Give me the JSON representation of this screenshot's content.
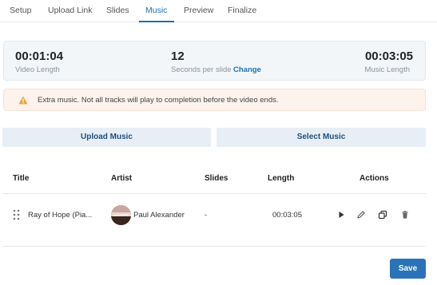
{
  "tabs": [
    {
      "label": "Setup"
    },
    {
      "label": "Upload Link"
    },
    {
      "label": "Slides"
    },
    {
      "label": "Music",
      "active": true
    },
    {
      "label": "Preview"
    },
    {
      "label": "Finalize"
    }
  ],
  "stats": {
    "video_length_value": "00:01:04",
    "video_length_label": "Video Length",
    "seconds_value": "12",
    "seconds_label": "Seconds per slide",
    "change_label": "Change",
    "music_length_value": "00:03:05",
    "music_length_label": "Music Length"
  },
  "warning": {
    "icon": "warning-triangle-icon",
    "text": "Extra music. Not all tracks will play to completion before the video ends."
  },
  "buttons": {
    "upload": "Upload Music",
    "select": "Select Music",
    "save": "Save"
  },
  "table": {
    "headers": [
      "Title",
      "Artist",
      "Slides",
      "Length",
      "Actions"
    ],
    "rows": [
      {
        "title": "Ray of Hope (Pia...",
        "artist": "Paul Alexander",
        "slides": "-",
        "length": "00:03:05"
      }
    ],
    "actions": [
      "play-icon",
      "edit-pencil-icon",
      "duplicate-icon",
      "trash-icon"
    ]
  },
  "colors": {
    "accent": "#1f6fb2",
    "warning_bg": "#fdf3ec",
    "warning_icon": "#e8a838",
    "button_bg": "#e8eef5",
    "save_bg": "#2a73b8"
  }
}
